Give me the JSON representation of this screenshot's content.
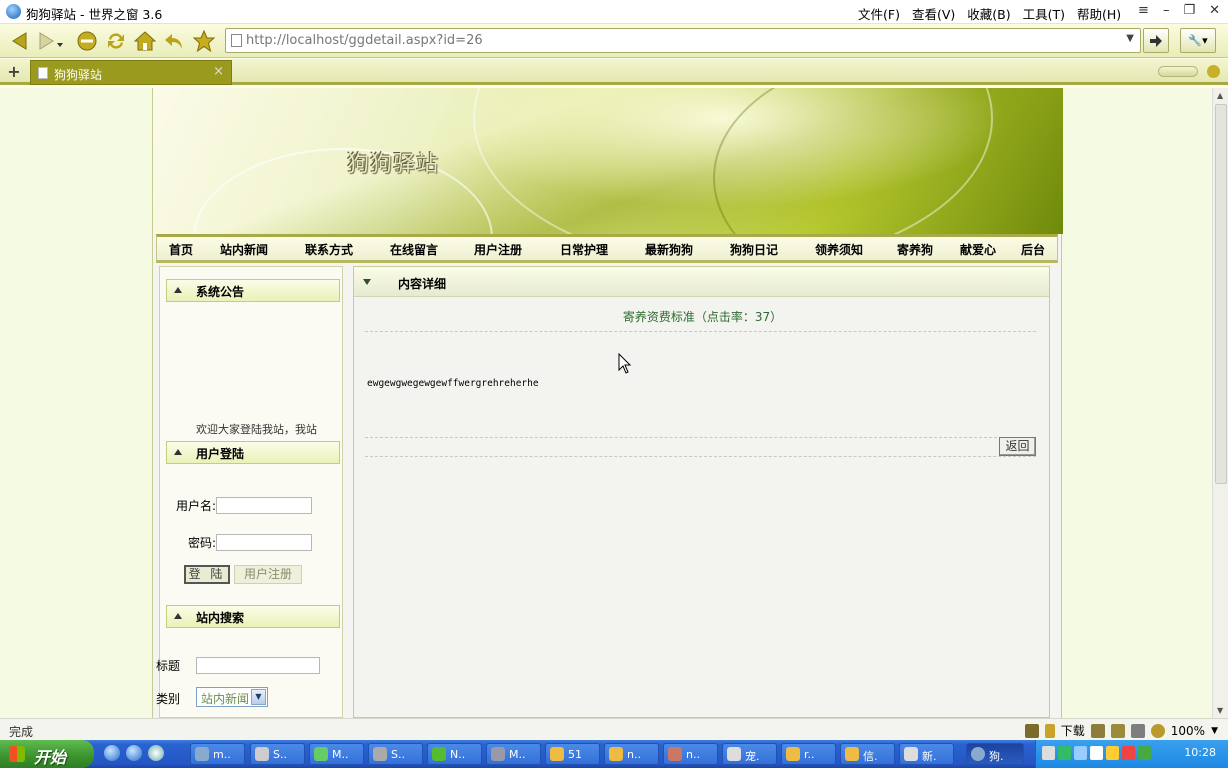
{
  "window": {
    "title": "狗狗驿站 - 世界之窗 3.6",
    "menus": [
      "文件(F)",
      "查看(V)",
      "收藏(B)",
      "工具(T)",
      "帮助(H)"
    ]
  },
  "toolbar": {
    "url": "http://localhost/ggdetail.aspx?id=26"
  },
  "tabs": [
    {
      "label": "狗狗驿站"
    }
  ],
  "site": {
    "title": "狗狗驿站",
    "nav": [
      "首页",
      "站内新闻",
      "联系方式",
      "在线留言",
      "用户注册",
      "日常护理",
      "最新狗狗",
      "狗狗日记",
      "领养须知",
      "寄养狗",
      "献爱心",
      "后台"
    ]
  },
  "sidebar": {
    "notice_title": "系统公告",
    "notice_text": "欢迎大家登陆我站，我站",
    "login_title": "用户登陆",
    "username_label": "用户名:",
    "password_label": "密码:",
    "login_button": "登 陆",
    "register_button": "用户注册",
    "search_title": "站内搜索",
    "title_label": "标题",
    "category_label": "类别",
    "category_value": "站内新闻"
  },
  "main": {
    "header": "内容详细",
    "article_title": "寄养资费标准（点击率：37）",
    "article_body": "ewgewgwegewgewffwergrehreherhe",
    "back_button": "返回"
  },
  "status": {
    "text": "完成",
    "download_label": "下载",
    "zoom": "100%"
  },
  "taskbar": {
    "start_label": "开始",
    "items": [
      "m..",
      "S..",
      "M..",
      "S..",
      "N..",
      "M..",
      "51",
      "n..",
      "n..",
      "宠.",
      "r..",
      "信.",
      "新.",
      "狗."
    ],
    "clock": "10:28"
  }
}
